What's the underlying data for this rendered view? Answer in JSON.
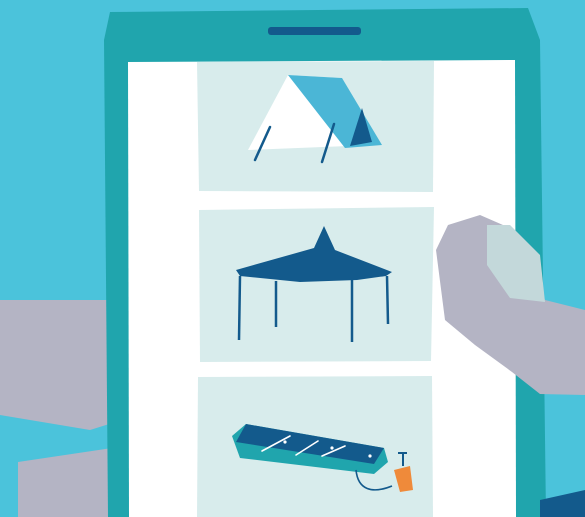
{
  "scene": {
    "colors": {
      "sky": "#4bc3db",
      "phone_body": "#20a5ad",
      "screen": "#ffffff",
      "card": "#d8ecec",
      "tent_white": "#ffffff",
      "tent_blue": "#4bb6d6",
      "navy": "#135a8c",
      "arm_gray": "#b4b4c4",
      "thumb": "#c3d8da",
      "mat_teal": "#20a5ad",
      "pump_orange": "#ef8a3a"
    },
    "cards": [
      {
        "icon": "tent-icon"
      },
      {
        "icon": "canopy-gazebo-icon"
      },
      {
        "icon": "inflatable-mat-pump-icon"
      }
    ]
  }
}
